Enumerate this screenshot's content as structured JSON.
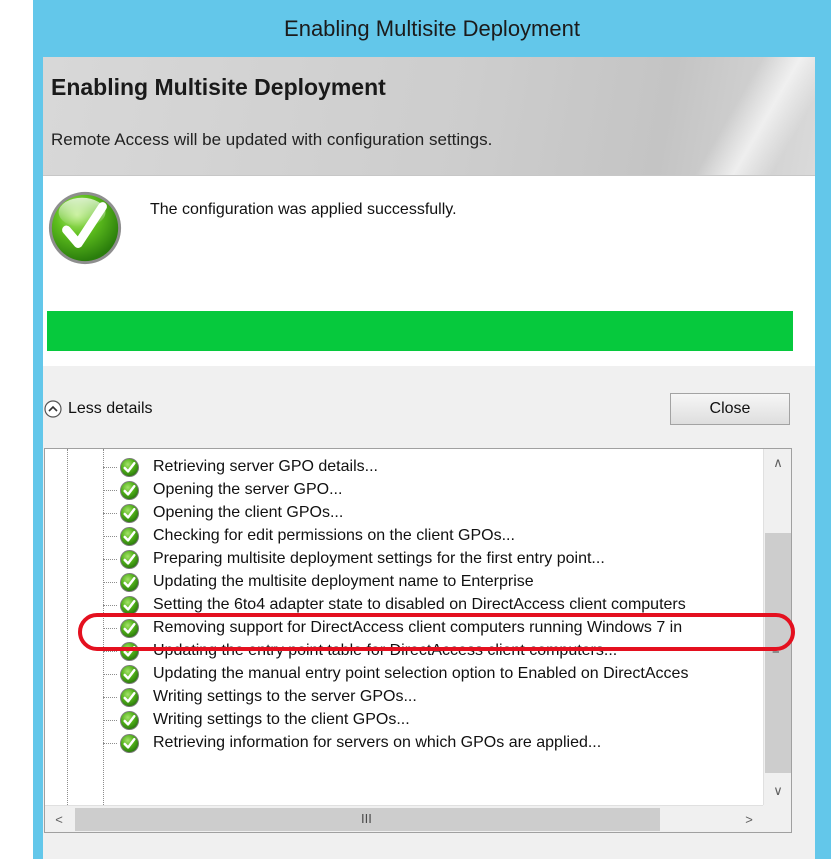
{
  "window": {
    "title": "Enabling Multisite Deployment"
  },
  "header": {
    "title": "Enabling Multisite Deployment",
    "subtitle": "Remote Access will be updated with configuration settings."
  },
  "status": {
    "message": "The configuration was applied successfully.",
    "progress_percent": 100,
    "progress_color": "#06c93d",
    "icon": "checkmark-icon"
  },
  "controls": {
    "less_details_label": "Less details",
    "close_label": "Close"
  },
  "details": {
    "items": [
      {
        "label": "Retrieving server GPO details...",
        "status": "success"
      },
      {
        "label": "Opening the server GPO...",
        "status": "success"
      },
      {
        "label": "Opening the client GPOs...",
        "status": "success"
      },
      {
        "label": "Checking for edit permissions on the client GPOs...",
        "status": "success"
      },
      {
        "label": "Preparing multisite deployment settings for the first entry point...",
        "status": "success"
      },
      {
        "label": "Updating the multisite deployment name to Enterprise",
        "status": "success"
      },
      {
        "label": "Setting the 6to4 adapter state to disabled on DirectAccess client computers",
        "status": "success"
      },
      {
        "label": "Removing support for DirectAccess client computers running Windows 7 in",
        "status": "success"
      },
      {
        "label": "Updating the entry point table for DirectAccess client computers...",
        "status": "success"
      },
      {
        "label": "Updating the manual entry point selection option to Enabled on DirectAcces",
        "status": "success"
      },
      {
        "label": "Writing settings to the server GPOs...",
        "status": "success"
      },
      {
        "label": "Writing settings to the client GPOs...",
        "status": "success"
      },
      {
        "label": "Retrieving information for servers on which GPOs are applied...",
        "status": "success"
      }
    ],
    "highlighted_index": 6,
    "highlight_color": "#e4101f"
  },
  "colors": {
    "title_bar": "#63c7ea",
    "success_green": "#06c93d"
  }
}
